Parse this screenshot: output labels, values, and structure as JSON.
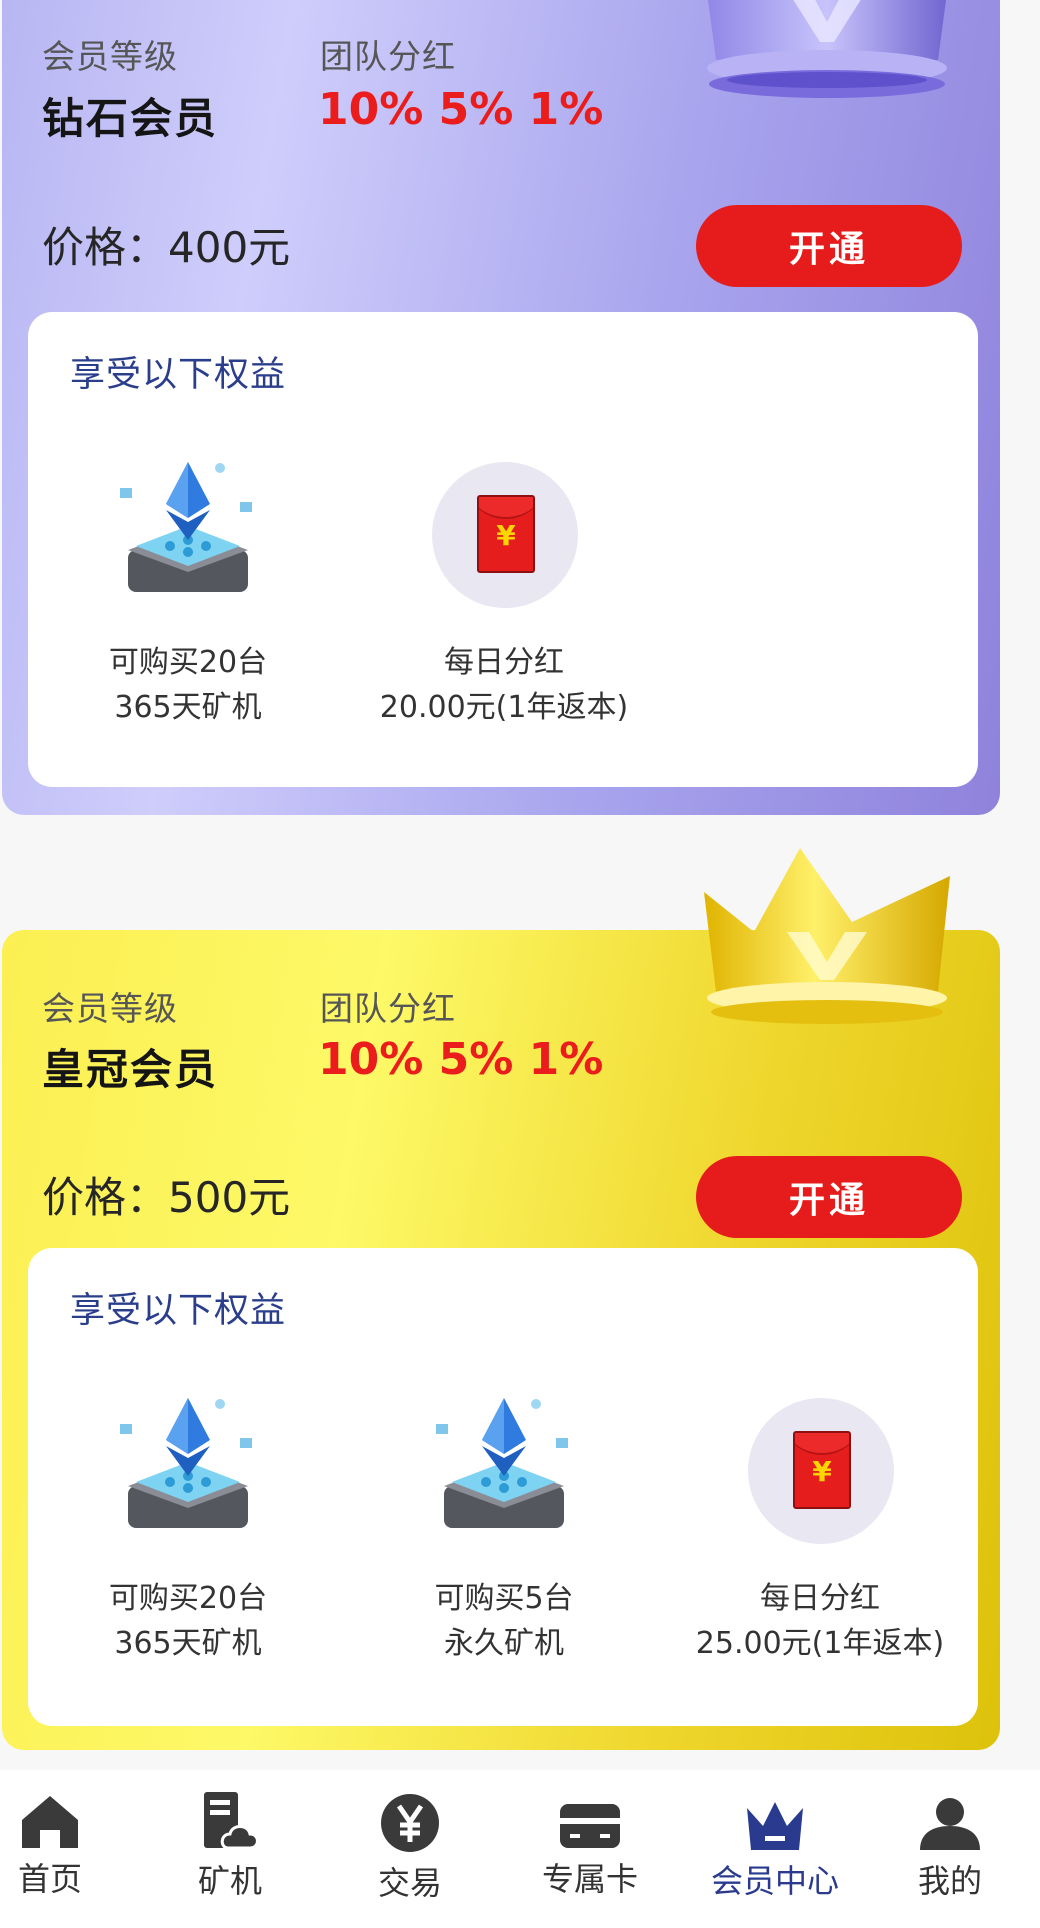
{
  "colors": {
    "accent_red": "#e61c1c",
    "nav_active": "#2a3b8f",
    "diamond_card": "#b7b6f2",
    "crown_card": "#f5e542"
  },
  "membership_cards": [
    {
      "level_label": "会员等级",
      "level_name": "钻石会员",
      "dividend_label": "团队分红",
      "dividend_rates": "10% 5% 1%",
      "price": "价格：400元",
      "open_button": "开通",
      "decoration_icon": "purple-crown-icon",
      "benefits_title": "享受以下权益",
      "benefits": [
        {
          "icon": "mining-machine-icon",
          "line1": "可购买20台",
          "line2": "365天矿机"
        },
        {
          "icon": "red-envelope-icon",
          "line1": "每日分红",
          "line2": "20.00元(1年返本)"
        }
      ]
    },
    {
      "level_label": "会员等级",
      "level_name": "皇冠会员",
      "dividend_label": "团队分红",
      "dividend_rates": "10% 5% 1%",
      "price": "价格：500元",
      "open_button": "开通",
      "decoration_icon": "gold-crown-icon",
      "benefits_title": "享受以下权益",
      "benefits": [
        {
          "icon": "mining-machine-icon",
          "line1": "可购买20台",
          "line2": "365天矿机"
        },
        {
          "icon": "mining-machine-icon",
          "line1": "可购买5台",
          "line2": "永久矿机"
        },
        {
          "icon": "red-envelope-icon",
          "line1": "每日分红",
          "line2": "25.00元(1年返本)"
        }
      ]
    }
  ],
  "envelope_symbol": "¥",
  "tabbar": {
    "active_index": 4,
    "items": [
      {
        "label": "首页",
        "icon": "home-icon"
      },
      {
        "label": "矿机",
        "icon": "miner-icon"
      },
      {
        "label": "交易",
        "icon": "yen-coin-icon"
      },
      {
        "label": "专属卡",
        "icon": "card-icon"
      },
      {
        "label": "会员中心",
        "icon": "crown-icon"
      },
      {
        "label": "我的",
        "icon": "user-icon"
      }
    ]
  }
}
